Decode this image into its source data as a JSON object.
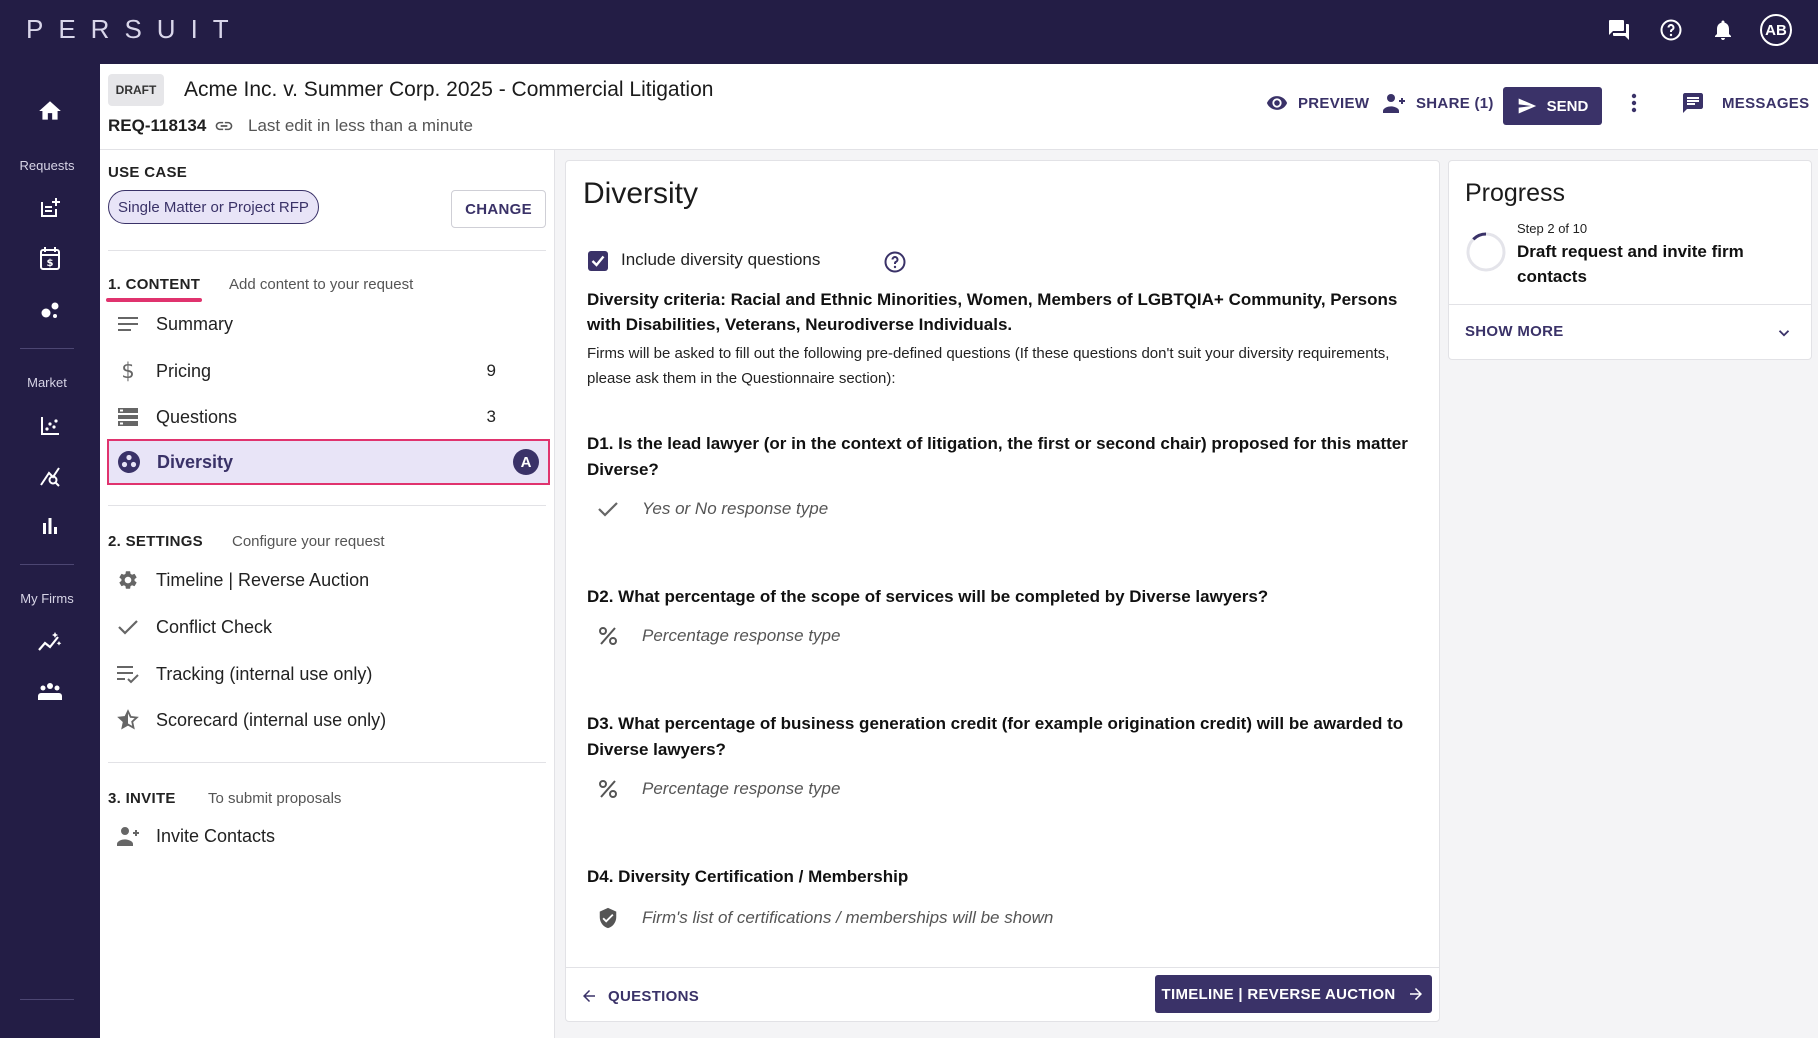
{
  "app": {
    "logo": "PERSUIT",
    "avatar": "AB"
  },
  "rail": {
    "requests": "Requests",
    "market": "Market",
    "my_firms": "My Firms"
  },
  "header": {
    "status": "DRAFT",
    "title": "Acme Inc. v. Summer Corp. 2025 - Commercial Litigation",
    "req_id": "REQ-118134",
    "last_edit": "Last edit in less than a minute",
    "preview": "PREVIEW",
    "share": "SHARE (1)",
    "send": "SEND",
    "messages": "MESSAGES"
  },
  "nav": {
    "use_case_label": "USE CASE",
    "use_case_value": "Single Matter or Project RFP",
    "change": "CHANGE",
    "content": {
      "label": "1. CONTENT",
      "sub": "Add content to your request"
    },
    "content_items": [
      {
        "label": "Summary",
        "count": ""
      },
      {
        "label": "Pricing",
        "count": "9"
      },
      {
        "label": "Questions",
        "count": "3"
      },
      {
        "label": "Diversity",
        "count": "A"
      }
    ],
    "settings": {
      "label": "2. SETTINGS",
      "sub": "Configure your request"
    },
    "settings_items": [
      {
        "label": "Timeline | Reverse Auction"
      },
      {
        "label": "Conflict Check"
      },
      {
        "label": "Tracking (internal use only)"
      },
      {
        "label": "Scorecard (internal use only)"
      }
    ],
    "invite": {
      "label": "3. INVITE",
      "sub": "To submit proposals"
    },
    "invite_items": [
      {
        "label": "Invite Contacts"
      }
    ]
  },
  "main": {
    "title": "Diversity",
    "checkbox_label": "Include diversity questions",
    "checkbox_checked": true,
    "criteria": "Diversity criteria: Racial and Ethnic Minorities, Women, Members of LGBTQIA+ Community, Persons with Disabilities, Veterans, Neurodiverse Individuals.",
    "criteria_note": "Firms will be asked to fill out the following pre-defined questions (If these questions don't suit your diversity requirements, please ask them in the Questionnaire section):",
    "questions": [
      {
        "title": "D1. Is the lead lawyer (or in the context of litigation, the first or second chair) proposed for this matter Diverse?",
        "response": "Yes or No response type",
        "icon": "check-icon"
      },
      {
        "title": "D2. What percentage of the scope of services will be completed by Diverse lawyers?",
        "response": "Percentage response type",
        "icon": "percent-icon"
      },
      {
        "title": "D3. What percentage of business generation credit (for example origination credit) will be awarded to Diverse lawyers?",
        "response": "Percentage response type",
        "icon": "percent-icon"
      },
      {
        "title": "D4. Diversity Certification / Membership",
        "response": "Firm's list of certifications / memberships will be shown",
        "icon": "shield-check-icon"
      }
    ],
    "back": "QUESTIONS",
    "next": "TIMELINE | REVERSE AUCTION"
  },
  "progress": {
    "title": "Progress",
    "step": "Step 2 of 10",
    "step_text": "Draft request and invite firm contacts",
    "show_more": "SHOW MORE"
  },
  "colors": {
    "brand": "#231d45",
    "accent": "#3a3268",
    "highlight": "#e0336e",
    "chip_bg": "#e8e4f7"
  }
}
